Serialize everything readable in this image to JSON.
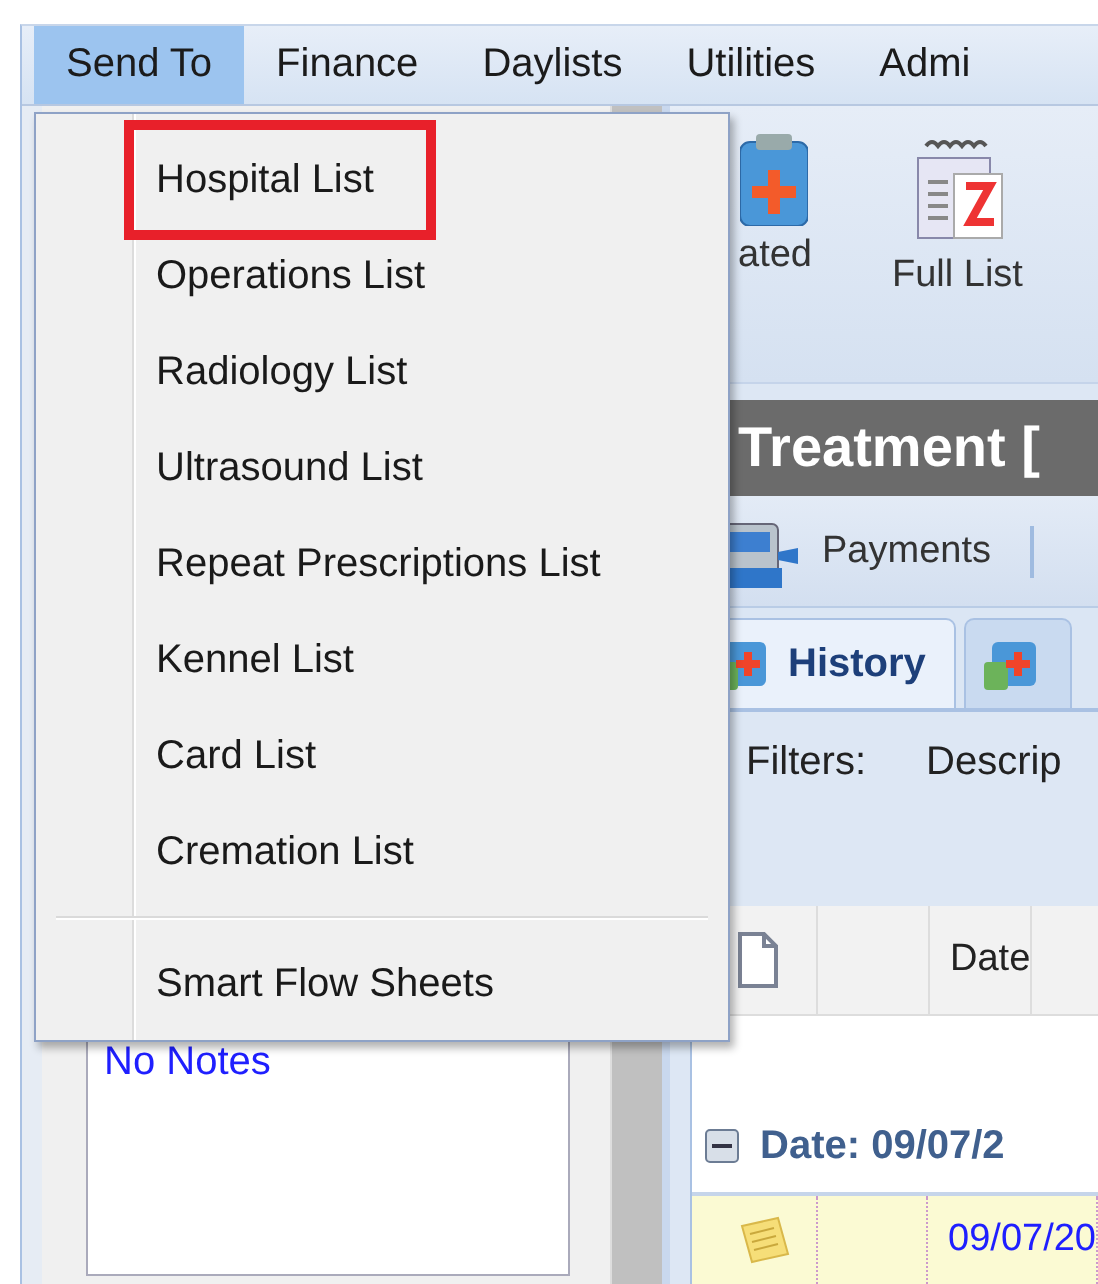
{
  "menu_bar": [
    {
      "label": "Send To",
      "selected": true
    },
    {
      "label": "Finance",
      "selected": false
    },
    {
      "label": "Daylists",
      "selected": false
    },
    {
      "label": "Utilities",
      "selected": false
    },
    {
      "label": "Admi",
      "selected": false
    }
  ],
  "dropdown": {
    "items": [
      {
        "kind": "item",
        "label": "Hospital List",
        "highlighted": true
      },
      {
        "kind": "item",
        "label": "Operations List",
        "highlighted": false
      },
      {
        "kind": "item",
        "label": "Radiology List",
        "highlighted": false
      },
      {
        "kind": "item",
        "label": "Ultrasound List",
        "highlighted": false
      },
      {
        "kind": "item",
        "label": "Repeat Prescriptions List",
        "highlighted": false
      },
      {
        "kind": "item",
        "label": "Kennel List",
        "highlighted": false
      },
      {
        "kind": "item",
        "label": "Card List",
        "highlighted": false
      },
      {
        "kind": "item",
        "label": "Cremation List",
        "highlighted": false
      },
      {
        "kind": "separator"
      },
      {
        "kind": "item",
        "label": "Smart Flow Sheets",
        "highlighted": false
      }
    ]
  },
  "toolbar": {
    "buttons": [
      {
        "kind": "clipboard",
        "label": "ated"
      },
      {
        "kind": "calendar",
        "label": "Full List"
      }
    ]
  },
  "title": "Treatment [",
  "action_bar": {
    "buttons": [
      {
        "kind": "till",
        "label": "Payments"
      }
    ]
  },
  "tabs": [
    {
      "label": "History",
      "selected": true
    },
    {
      "selected": false
    }
  ],
  "filters": {
    "label": "Filters:",
    "field_label": "Descrip"
  },
  "grid": {
    "columns": [
      "Date"
    ],
    "groups": [
      {
        "label": "Date: 09/07/2",
        "expanded": true,
        "rows": [
          {
            "date": "09/07/20"
          }
        ]
      }
    ]
  },
  "notes": {
    "text": "No Notes"
  }
}
